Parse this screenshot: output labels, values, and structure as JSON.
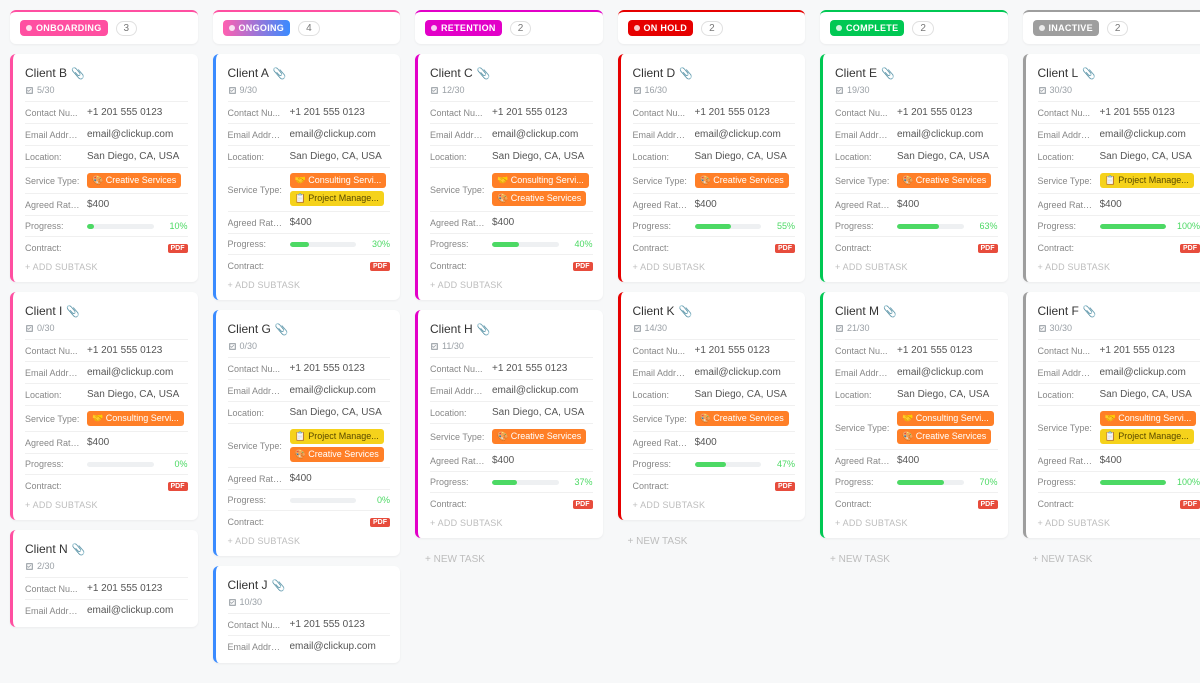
{
  "labels": {
    "contact": "Contact Nu...",
    "email": "Email Addre...",
    "location": "Location:",
    "service": "Service Type:",
    "rate": "Agreed Rate:...",
    "progress": "Progress:",
    "contract": "Contract:",
    "add_subtask": "ADD SUBTASK",
    "new_task": "NEW TASK"
  },
  "defaults": {
    "phone": "+1 201 555 0123",
    "email": "email@clickup.com",
    "location": "San Diego, CA, USA",
    "rate": "$400",
    "pdf": "PDF"
  },
  "service_tags": {
    "creative": {
      "text": "🎨 Creative Services",
      "bg": "#ff7f27"
    },
    "consulting": {
      "text": "🤝 Consulting Servi...",
      "bg": "#ff7f27"
    },
    "project_mgmt_y": {
      "text": "📋 Project Manage...",
      "bg": "#f5d21b"
    },
    "project_mgmt_o": {
      "text": "📋 Project Manage...",
      "bg": "#ff7f27"
    }
  },
  "columns": [
    {
      "name": "ONBOARDING",
      "count": "3",
      "color": "#ff4fa1",
      "header_top": "#ff4fa1",
      "cards": [
        {
          "title": "Client B",
          "sub": "5/30",
          "services": [
            "creative"
          ],
          "progress": 10
        },
        {
          "title": "Client I",
          "sub": "0/30",
          "services": [
            "consulting"
          ],
          "progress": 0
        },
        {
          "title": "Client N",
          "sub": "2/30",
          "truncated": true
        }
      ]
    },
    {
      "name": "ONGOING",
      "count": "4",
      "color": "#3a8bff",
      "header_top": "#ff4fa1",
      "pill_gradient": "linear-gradient(90deg,#ff5fb0,#3a8bff)",
      "cards": [
        {
          "title": "Client A",
          "sub": "9/30",
          "services": [
            "consulting",
            "project_mgmt_y"
          ],
          "progress": 30
        },
        {
          "title": "Client G",
          "sub": "0/30",
          "services": [
            "project_mgmt_y",
            "creative"
          ],
          "progress": 0
        },
        {
          "title": "Client J",
          "sub": "10/30",
          "truncated": true
        }
      ]
    },
    {
      "name": "RETENTION",
      "count": "2",
      "color": "#e200c8",
      "header_top": "#e200c8",
      "cards": [
        {
          "title": "Client C",
          "sub": "12/30",
          "services": [
            "consulting",
            "creative"
          ],
          "progress": 40
        },
        {
          "title": "Client H",
          "sub": "11/30",
          "services": [
            "creative"
          ],
          "progress": 37
        }
      ],
      "show_new_task": true
    },
    {
      "name": "ON HOLD",
      "count": "2",
      "color": "#e60000",
      "header_top": "#e60000",
      "cards": [
        {
          "title": "Client D",
          "sub": "16/30",
          "services": [
            "creative"
          ],
          "progress": 55
        },
        {
          "title": "Client K",
          "sub": "14/30",
          "services": [
            "creative"
          ],
          "progress": 47
        }
      ],
      "show_new_task": true
    },
    {
      "name": "COMPLETE",
      "count": "2",
      "color": "#00c853",
      "header_top": "#00c853",
      "cards": [
        {
          "title": "Client E",
          "sub": "19/30",
          "services": [
            "creative"
          ],
          "progress": 63
        },
        {
          "title": "Client M",
          "sub": "21/30",
          "services": [
            "consulting",
            "creative"
          ],
          "progress": 70
        }
      ],
      "show_new_task": true
    },
    {
      "name": "INACTIVE",
      "count": "2",
      "color": "#9e9e9e",
      "header_top": "#9e9e9e",
      "cards": [
        {
          "title": "Client L",
          "sub": "30/30",
          "services": [
            "project_mgmt_y"
          ],
          "progress": 100
        },
        {
          "title": "Client F",
          "sub": "30/30",
          "services": [
            "consulting",
            "project_mgmt_y"
          ],
          "progress": 100
        }
      ],
      "show_new_task": true
    }
  ]
}
